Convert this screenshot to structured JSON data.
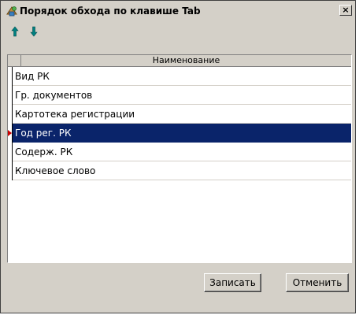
{
  "window": {
    "title": "Порядок обхода по клавише Tab",
    "close_label": "×"
  },
  "toolbar": {
    "up_icon": "arrow-up-icon",
    "down_icon": "arrow-down-icon",
    "icon_color": "#008080"
  },
  "grid": {
    "header": "Наименование",
    "rows": [
      {
        "label": "Вид РК",
        "selected": false
      },
      {
        "label": "Гр. документов",
        "selected": false
      },
      {
        "label": "Картотека регистрации",
        "selected": false
      },
      {
        "label": "Год рег. РК",
        "selected": true
      },
      {
        "label": "Содерж. РК",
        "selected": false
      },
      {
        "label": "Ключевое слово",
        "selected": false
      }
    ],
    "selection_color": "#0a246a",
    "indicator_color": "#cc0000"
  },
  "buttons": {
    "save": "Записать",
    "cancel": "Отменить"
  }
}
